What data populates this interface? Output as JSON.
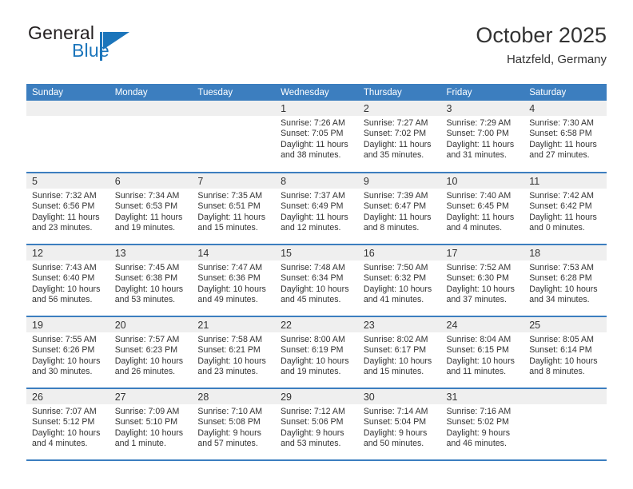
{
  "brand": {
    "name_top": "General",
    "name_bottom": "Blue",
    "accent_color": "#1b75bb"
  },
  "header": {
    "month_title": "October 2025",
    "location": "Hatzfeld, Germany"
  },
  "theme": {
    "header_blue": "#3c7ebf",
    "daynum_band": "#efefef",
    "text": "#333333"
  },
  "weekday_headers": [
    "Sunday",
    "Monday",
    "Tuesday",
    "Wednesday",
    "Thursday",
    "Friday",
    "Saturday"
  ],
  "weeks": [
    [
      {
        "day": "",
        "empty": true,
        "sunrise": "",
        "sunset": "",
        "daylight1": "",
        "daylight2": ""
      },
      {
        "day": "",
        "empty": true,
        "sunrise": "",
        "sunset": "",
        "daylight1": "",
        "daylight2": ""
      },
      {
        "day": "",
        "empty": true,
        "sunrise": "",
        "sunset": "",
        "daylight1": "",
        "daylight2": ""
      },
      {
        "day": "1",
        "sunrise": "Sunrise: 7:26 AM",
        "sunset": "Sunset: 7:05 PM",
        "daylight1": "Daylight: 11 hours",
        "daylight2": "and 38 minutes."
      },
      {
        "day": "2",
        "sunrise": "Sunrise: 7:27 AM",
        "sunset": "Sunset: 7:02 PM",
        "daylight1": "Daylight: 11 hours",
        "daylight2": "and 35 minutes."
      },
      {
        "day": "3",
        "sunrise": "Sunrise: 7:29 AM",
        "sunset": "Sunset: 7:00 PM",
        "daylight1": "Daylight: 11 hours",
        "daylight2": "and 31 minutes."
      },
      {
        "day": "4",
        "sunrise": "Sunrise: 7:30 AM",
        "sunset": "Sunset: 6:58 PM",
        "daylight1": "Daylight: 11 hours",
        "daylight2": "and 27 minutes."
      }
    ],
    [
      {
        "day": "5",
        "sunrise": "Sunrise: 7:32 AM",
        "sunset": "Sunset: 6:56 PM",
        "daylight1": "Daylight: 11 hours",
        "daylight2": "and 23 minutes."
      },
      {
        "day": "6",
        "sunrise": "Sunrise: 7:34 AM",
        "sunset": "Sunset: 6:53 PM",
        "daylight1": "Daylight: 11 hours",
        "daylight2": "and 19 minutes."
      },
      {
        "day": "7",
        "sunrise": "Sunrise: 7:35 AM",
        "sunset": "Sunset: 6:51 PM",
        "daylight1": "Daylight: 11 hours",
        "daylight2": "and 15 minutes."
      },
      {
        "day": "8",
        "sunrise": "Sunrise: 7:37 AM",
        "sunset": "Sunset: 6:49 PM",
        "daylight1": "Daylight: 11 hours",
        "daylight2": "and 12 minutes."
      },
      {
        "day": "9",
        "sunrise": "Sunrise: 7:39 AM",
        "sunset": "Sunset: 6:47 PM",
        "daylight1": "Daylight: 11 hours",
        "daylight2": "and 8 minutes."
      },
      {
        "day": "10",
        "sunrise": "Sunrise: 7:40 AM",
        "sunset": "Sunset: 6:45 PM",
        "daylight1": "Daylight: 11 hours",
        "daylight2": "and 4 minutes."
      },
      {
        "day": "11",
        "sunrise": "Sunrise: 7:42 AM",
        "sunset": "Sunset: 6:42 PM",
        "daylight1": "Daylight: 11 hours",
        "daylight2": "and 0 minutes."
      }
    ],
    [
      {
        "day": "12",
        "sunrise": "Sunrise: 7:43 AM",
        "sunset": "Sunset: 6:40 PM",
        "daylight1": "Daylight: 10 hours",
        "daylight2": "and 56 minutes."
      },
      {
        "day": "13",
        "sunrise": "Sunrise: 7:45 AM",
        "sunset": "Sunset: 6:38 PM",
        "daylight1": "Daylight: 10 hours",
        "daylight2": "and 53 minutes."
      },
      {
        "day": "14",
        "sunrise": "Sunrise: 7:47 AM",
        "sunset": "Sunset: 6:36 PM",
        "daylight1": "Daylight: 10 hours",
        "daylight2": "and 49 minutes."
      },
      {
        "day": "15",
        "sunrise": "Sunrise: 7:48 AM",
        "sunset": "Sunset: 6:34 PM",
        "daylight1": "Daylight: 10 hours",
        "daylight2": "and 45 minutes."
      },
      {
        "day": "16",
        "sunrise": "Sunrise: 7:50 AM",
        "sunset": "Sunset: 6:32 PM",
        "daylight1": "Daylight: 10 hours",
        "daylight2": "and 41 minutes."
      },
      {
        "day": "17",
        "sunrise": "Sunrise: 7:52 AM",
        "sunset": "Sunset: 6:30 PM",
        "daylight1": "Daylight: 10 hours",
        "daylight2": "and 37 minutes."
      },
      {
        "day": "18",
        "sunrise": "Sunrise: 7:53 AM",
        "sunset": "Sunset: 6:28 PM",
        "daylight1": "Daylight: 10 hours",
        "daylight2": "and 34 minutes."
      }
    ],
    [
      {
        "day": "19",
        "sunrise": "Sunrise: 7:55 AM",
        "sunset": "Sunset: 6:26 PM",
        "daylight1": "Daylight: 10 hours",
        "daylight2": "and 30 minutes."
      },
      {
        "day": "20",
        "sunrise": "Sunrise: 7:57 AM",
        "sunset": "Sunset: 6:23 PM",
        "daylight1": "Daylight: 10 hours",
        "daylight2": "and 26 minutes."
      },
      {
        "day": "21",
        "sunrise": "Sunrise: 7:58 AM",
        "sunset": "Sunset: 6:21 PM",
        "daylight1": "Daylight: 10 hours",
        "daylight2": "and 23 minutes."
      },
      {
        "day": "22",
        "sunrise": "Sunrise: 8:00 AM",
        "sunset": "Sunset: 6:19 PM",
        "daylight1": "Daylight: 10 hours",
        "daylight2": "and 19 minutes."
      },
      {
        "day": "23",
        "sunrise": "Sunrise: 8:02 AM",
        "sunset": "Sunset: 6:17 PM",
        "daylight1": "Daylight: 10 hours",
        "daylight2": "and 15 minutes."
      },
      {
        "day": "24",
        "sunrise": "Sunrise: 8:04 AM",
        "sunset": "Sunset: 6:15 PM",
        "daylight1": "Daylight: 10 hours",
        "daylight2": "and 11 minutes."
      },
      {
        "day": "25",
        "sunrise": "Sunrise: 8:05 AM",
        "sunset": "Sunset: 6:14 PM",
        "daylight1": "Daylight: 10 hours",
        "daylight2": "and 8 minutes."
      }
    ],
    [
      {
        "day": "26",
        "sunrise": "Sunrise: 7:07 AM",
        "sunset": "Sunset: 5:12 PM",
        "daylight1": "Daylight: 10 hours",
        "daylight2": "and 4 minutes."
      },
      {
        "day": "27",
        "sunrise": "Sunrise: 7:09 AM",
        "sunset": "Sunset: 5:10 PM",
        "daylight1": "Daylight: 10 hours",
        "daylight2": "and 1 minute."
      },
      {
        "day": "28",
        "sunrise": "Sunrise: 7:10 AM",
        "sunset": "Sunset: 5:08 PM",
        "daylight1": "Daylight: 9 hours",
        "daylight2": "and 57 minutes."
      },
      {
        "day": "29",
        "sunrise": "Sunrise: 7:12 AM",
        "sunset": "Sunset: 5:06 PM",
        "daylight1": "Daylight: 9 hours",
        "daylight2": "and 53 minutes."
      },
      {
        "day": "30",
        "sunrise": "Sunrise: 7:14 AM",
        "sunset": "Sunset: 5:04 PM",
        "daylight1": "Daylight: 9 hours",
        "daylight2": "and 50 minutes."
      },
      {
        "day": "31",
        "sunrise": "Sunrise: 7:16 AM",
        "sunset": "Sunset: 5:02 PM",
        "daylight1": "Daylight: 9 hours",
        "daylight2": "and 46 minutes."
      },
      {
        "day": "",
        "empty": true,
        "sunrise": "",
        "sunset": "",
        "daylight1": "",
        "daylight2": ""
      }
    ]
  ]
}
